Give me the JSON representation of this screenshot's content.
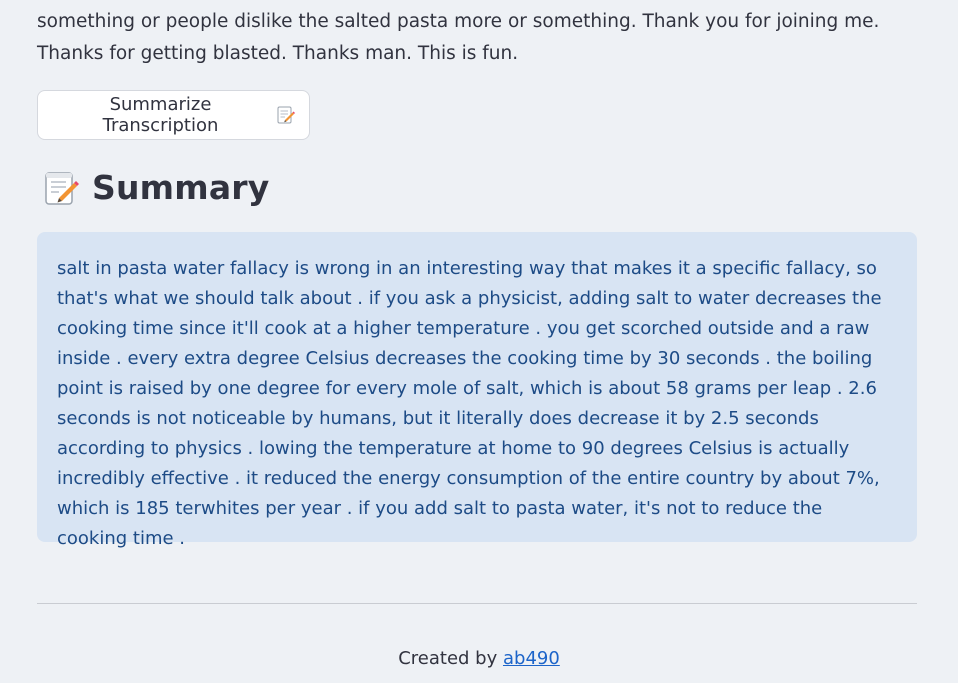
{
  "transcript_tail": "something or people dislike the salted pasta more or something. Thank you for joining me. Thanks for getting blasted. Thanks man. This is fun.",
  "summarize_button": {
    "label": "Summarize Transcription",
    "icon": "memo-icon"
  },
  "summary": {
    "heading": "Summary",
    "icon": "memo-icon",
    "text": "salt in pasta water fallacy is wrong in an interesting way that makes it a specific fallacy, so that's what we should talk about . if you ask a physicist, adding salt to water decreases the cooking time since it'll cook at a higher temperature . you get scorched outside and a raw inside . every extra degree Celsius decreases the cooking time by 30 seconds . the boiling point is raised by one degree for every mole of salt, which is about 58 grams per leap . 2.6 seconds is not noticeable by humans, but it literally does decrease it by 2.5 seconds according to physics . lowing the temperature at home to 90 degrees Celsius is actually incredibly effective . it reduced the energy consumption of the entire country by about 7%, which is 185 terwhites per year . if you add salt to pasta water, it's not to reduce the cooking time ."
  },
  "footer": {
    "prefix": "Created by",
    "author_link": "ab490"
  },
  "colors": {
    "background": "#eef1f5",
    "summary_box": "#d8e4f3",
    "summary_text": "#1d4b86",
    "link": "#1c64c9"
  }
}
